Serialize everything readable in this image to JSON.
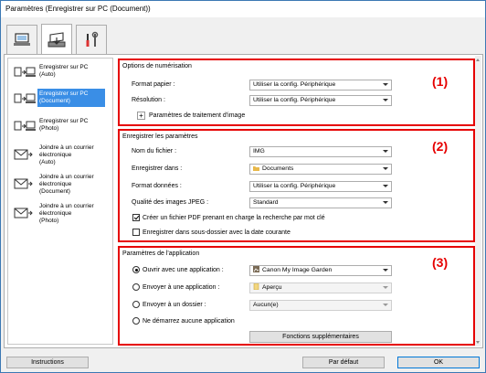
{
  "window": {
    "title": "Paramètres (Enregistrer sur PC (Document))"
  },
  "top_tabs": [
    {
      "name": "scan-from-computer",
      "icon": "computer-scan-icon",
      "active": false
    },
    {
      "name": "scan-from-panel",
      "icon": "scanner-panel-icon",
      "active": true
    },
    {
      "name": "general-settings",
      "icon": "tools-icon",
      "active": false
    }
  ],
  "sidebar": {
    "items": [
      {
        "label": "Enregistrer sur PC\n(Auto)",
        "icon": "save-pc-icon",
        "selected": false
      },
      {
        "label": "Enregistrer sur PC\n(Document)",
        "icon": "save-pc-icon",
        "selected": true
      },
      {
        "label": "Enregistrer sur PC\n(Photo)",
        "icon": "save-pc-icon",
        "selected": false
      },
      {
        "label": "Joindre à un courrier\nélectronique\n(Auto)",
        "icon": "email-icon",
        "selected": false
      },
      {
        "label": "Joindre à un courrier\nélectronique\n(Document)",
        "icon": "email-icon",
        "selected": false
      },
      {
        "label": "Joindre à un courrier\nélectronique\n(Photo)",
        "icon": "email-icon",
        "selected": false
      }
    ]
  },
  "scan_options": {
    "title": "Options de numérisation",
    "paper_size_label": "Format papier :",
    "paper_size_value": "Utiliser la config. Périphérique",
    "resolution_label": "Résolution :",
    "resolution_value": "Utiliser la config. Périphérique",
    "image_processing_label": "Paramètres de traitement d'image",
    "expand_symbol": "+",
    "marker": "(1)"
  },
  "save_settings": {
    "title": "Enregistrer les paramètres",
    "file_name_label": "Nom du fichier :",
    "file_name_value": "IMG",
    "save_in_label": "Enregistrer dans :",
    "save_in_value": "Documents",
    "data_format_label": "Format données :",
    "data_format_value": "Utiliser la config. Périphérique",
    "jpeg_quality_label": "Qualité des images JPEG :",
    "jpeg_quality_value": "Standard",
    "pdf_keyword_label": "Créer un fichier PDF prenant en charge la recherche par mot clé",
    "pdf_keyword_checked": true,
    "subfolder_label": "Enregistrer dans sous-dossier avec la date courante",
    "subfolder_checked": false,
    "marker": "(2)"
  },
  "app_settings": {
    "title": "Paramètres de l'application",
    "open_app_label": "Ouvrir avec une application :",
    "open_app_value": "Canon My Image Garden",
    "send_app_label": "Envoyer à une application :",
    "send_app_value": "Aperçu",
    "send_folder_label": "Envoyer à un dossier :",
    "send_folder_value": "Aucun(e)",
    "no_app_label": "Ne démarrez aucune application",
    "selected_option": "open_app",
    "more_functions_label": "Fonctions supplémentaires",
    "marker": "(3)"
  },
  "footer": {
    "instructions_label": "Instructions",
    "default_label": "Par défaut",
    "ok_label": "OK"
  },
  "colors": {
    "accent": "#e60000",
    "selection": "#3a8ee6"
  }
}
